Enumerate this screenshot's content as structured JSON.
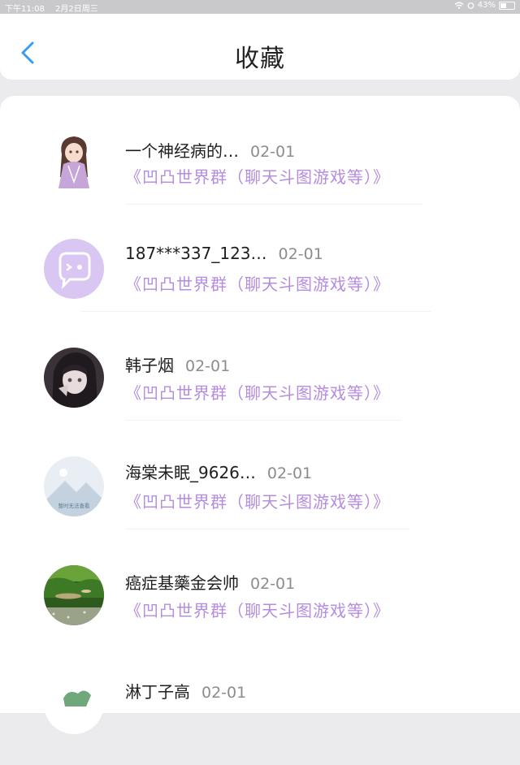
{
  "status_bar": {
    "time": "下午11:08",
    "date": "2月2日周三",
    "battery": "43%"
  },
  "header": {
    "title": "收藏"
  },
  "favorites": [
    {
      "name": "一个神经病的…",
      "date": "02-01",
      "group": "《凹凸世界群（聊天斗图游戏等）》",
      "avatar": "anime-girl-avatar"
    },
    {
      "name": "187***337_123…",
      "date": "02-01",
      "group": "《凹凸世界群（聊天斗图游戏等）》",
      "avatar": "chat-bubble-avatar"
    },
    {
      "name": "韩子烟",
      "date": "02-01",
      "group": "《凹凸世界群（聊天斗图游戏等）》",
      "avatar": "dark-anime-avatar"
    },
    {
      "name": "海棠未眠_9626…",
      "date": "02-01",
      "group": "《凹凸世界群（聊天斗图游戏等）》",
      "avatar": "placeholder-avatar",
      "avatar_text": "暂时无法查看"
    },
    {
      "name": "癌症基藥金会帅",
      "date": "02-01",
      "group": "《凹凸世界群（聊天斗图游戏等）》",
      "avatar": "fish-tank-avatar"
    },
    {
      "name": "淋丁子高",
      "date": "02-01",
      "group": "",
      "avatar": "green-avatar"
    }
  ]
}
